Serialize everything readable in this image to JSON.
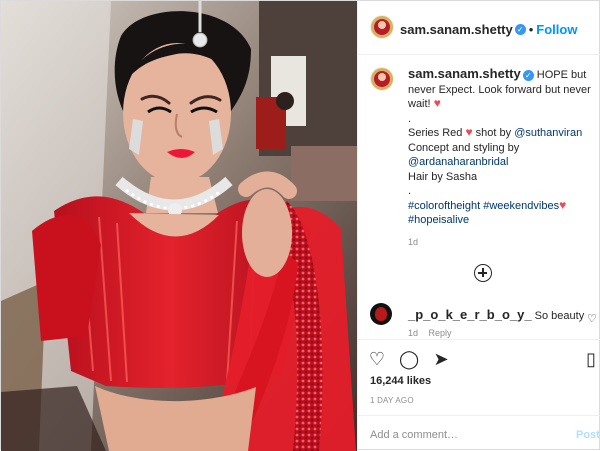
{
  "post": {
    "username": "sam.sanam.shetty",
    "follow": "Follow",
    "caption_intro": "HOPE but never Expect. Look forward but never wait!",
    "caption_dot1": ".",
    "series_text": "Series Red",
    "shot_by": "shot by",
    "mention_photographer": "@suthanviran",
    "concept": "Concept and styling by",
    "mention_stylist": "@ardanaharanbridal",
    "hair": "Hair by Sasha",
    "caption_dot2": ".",
    "hashtags_line1": "#coloroftheight",
    "hashtags_line1b": "#weekendvibes",
    "hashtags_line2": "#hopeisalive",
    "caption_time": "1d"
  },
  "comment": {
    "username": "_p_o_k_e_r_b_o_y_",
    "text": "So beauty",
    "time": "1d",
    "reply": "Reply"
  },
  "footer": {
    "likes": "16,244 likes",
    "posted": "1 DAY AGO",
    "add_comment_placeholder": "Add a comment…",
    "post_label": "Post"
  },
  "colors": {
    "brand_blue": "#0095f6",
    "heart_red": "#ed4956",
    "dress_red": "#d7141f"
  },
  "icons": [
    "verified-icon",
    "heart-icon",
    "comment-icon",
    "share-icon",
    "bookmark-icon",
    "load-more-icon",
    "comment-like-icon"
  ]
}
